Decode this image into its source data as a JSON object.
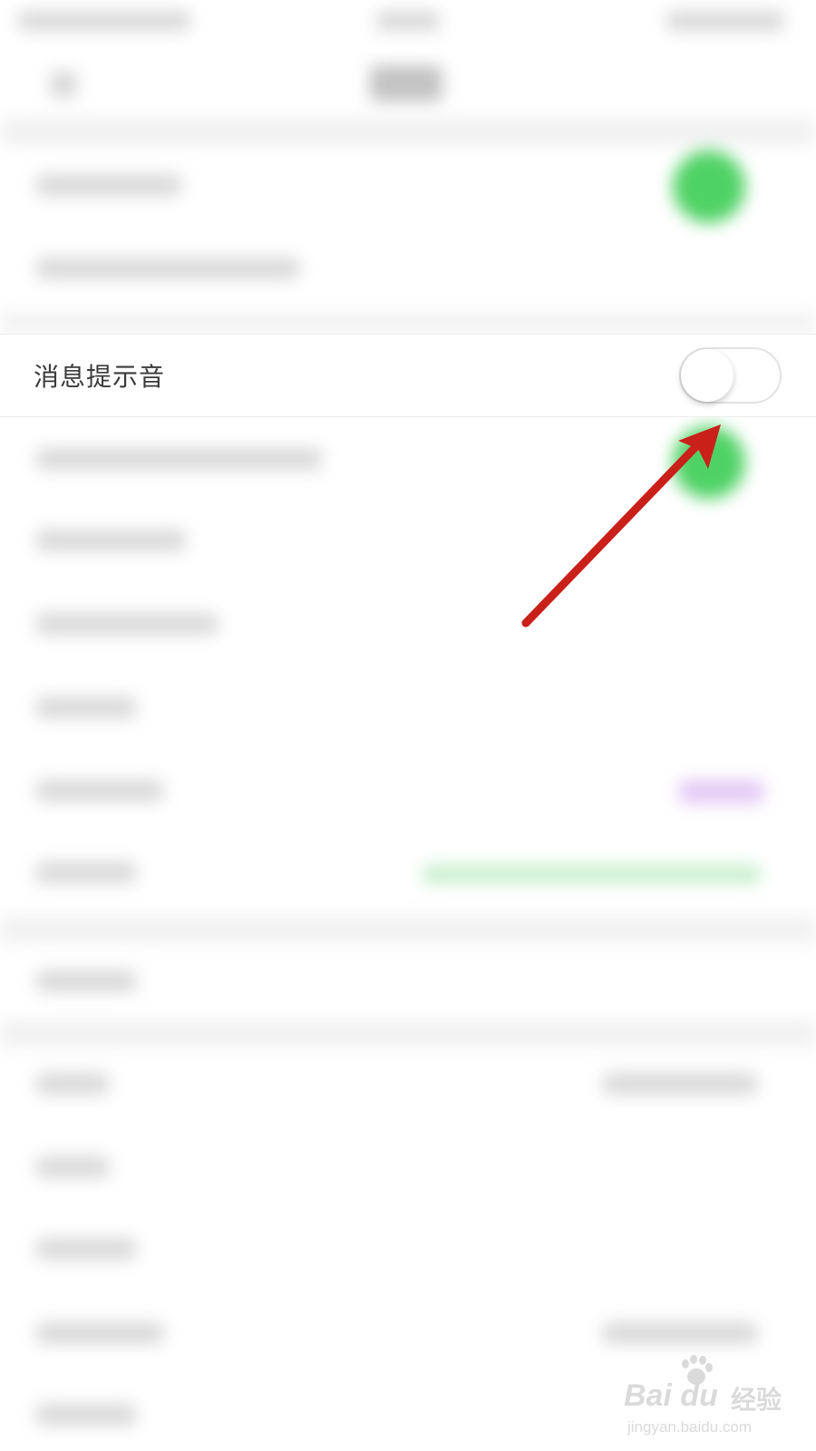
{
  "setting": {
    "label": "消息提示音",
    "enabled": false
  },
  "watermark": {
    "logo": "Bai du",
    "chinese": "经验",
    "url": "jingyan.baidu.com"
  },
  "colors": {
    "arrow": "#c9201a",
    "toggle_off_border": "#e2e2e2",
    "blurred_green": "#4fd264"
  },
  "icons": {
    "annotation": "red-arrow-icon",
    "watermark_paw": "paw-icon"
  }
}
